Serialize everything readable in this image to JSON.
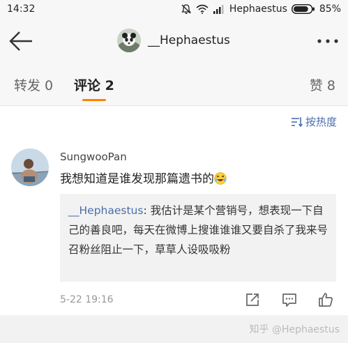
{
  "status_bar": {
    "time": "14:32",
    "carrier": "Hephaestus",
    "battery": "85%",
    "battery_level": 0.85
  },
  "header": {
    "title": "__Hephaestus",
    "icons": [
      "back-arrow-icon",
      "avatar",
      "more-icon"
    ]
  },
  "tabs": {
    "repost": "转发 0",
    "comment": "评论 2",
    "like": "赞 8"
  },
  "sort": {
    "label": "按热度"
  },
  "comment": {
    "username": "SungwooPan",
    "text": "我想知道是谁发现那篇遗书的",
    "quote_user": "__Hephaestus",
    "quote_text": ": 我估计是某个营销号，想表现一下自己的善良吧，每天在微博上搜谁谁谁又要自杀了我来号召粉丝阻止一下，草草人设吸吸粉",
    "time": "5-22 19:16"
  },
  "footer": {
    "watermark": "知乎 @Hephaestus"
  },
  "colors": {
    "accent": "#ff8200",
    "link": "#4b6eaa"
  }
}
